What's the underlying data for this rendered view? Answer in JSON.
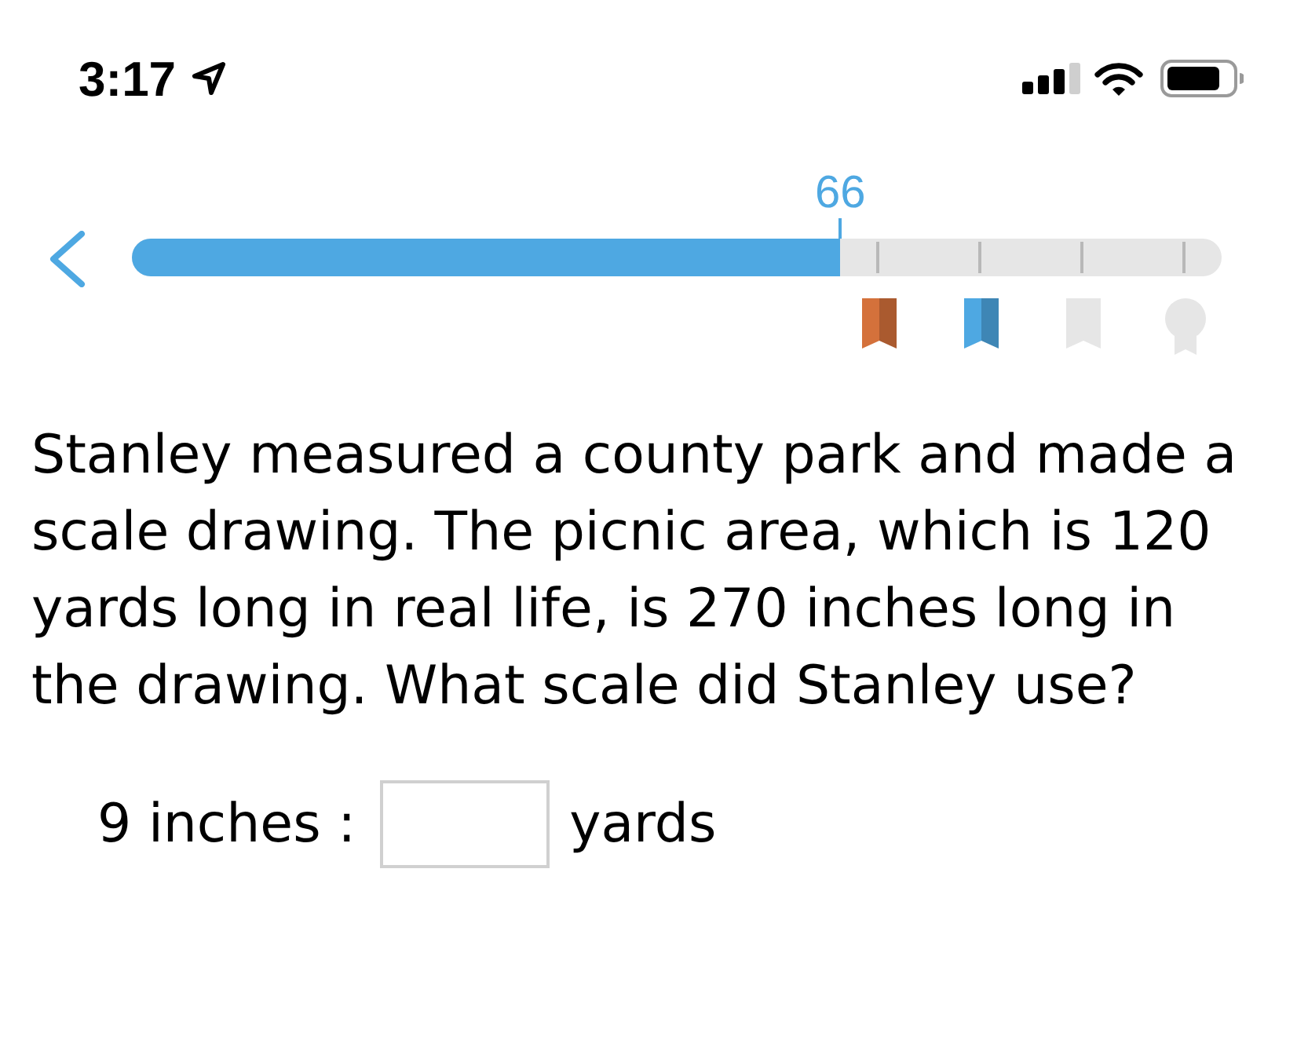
{
  "status_bar": {
    "time": "3:17"
  },
  "progress": {
    "score": "66",
    "level": 0.65
  },
  "awards": [
    {
      "kind": "ribbon",
      "earned": true,
      "color": "#d4713b"
    },
    {
      "kind": "ribbon",
      "earned": true,
      "color": "#4ea8e2"
    },
    {
      "kind": "ribbon",
      "earned": false
    },
    {
      "kind": "medal",
      "earned": false
    }
  ],
  "question": {
    "text": "Stanley measured a county park and made a scale drawing. The picnic area, which is 120 yards long in real life, is 270 inches long in the drawing. What scale did Stanley use?",
    "answer": {
      "before": "9 inches :",
      "after": "yards"
    }
  }
}
